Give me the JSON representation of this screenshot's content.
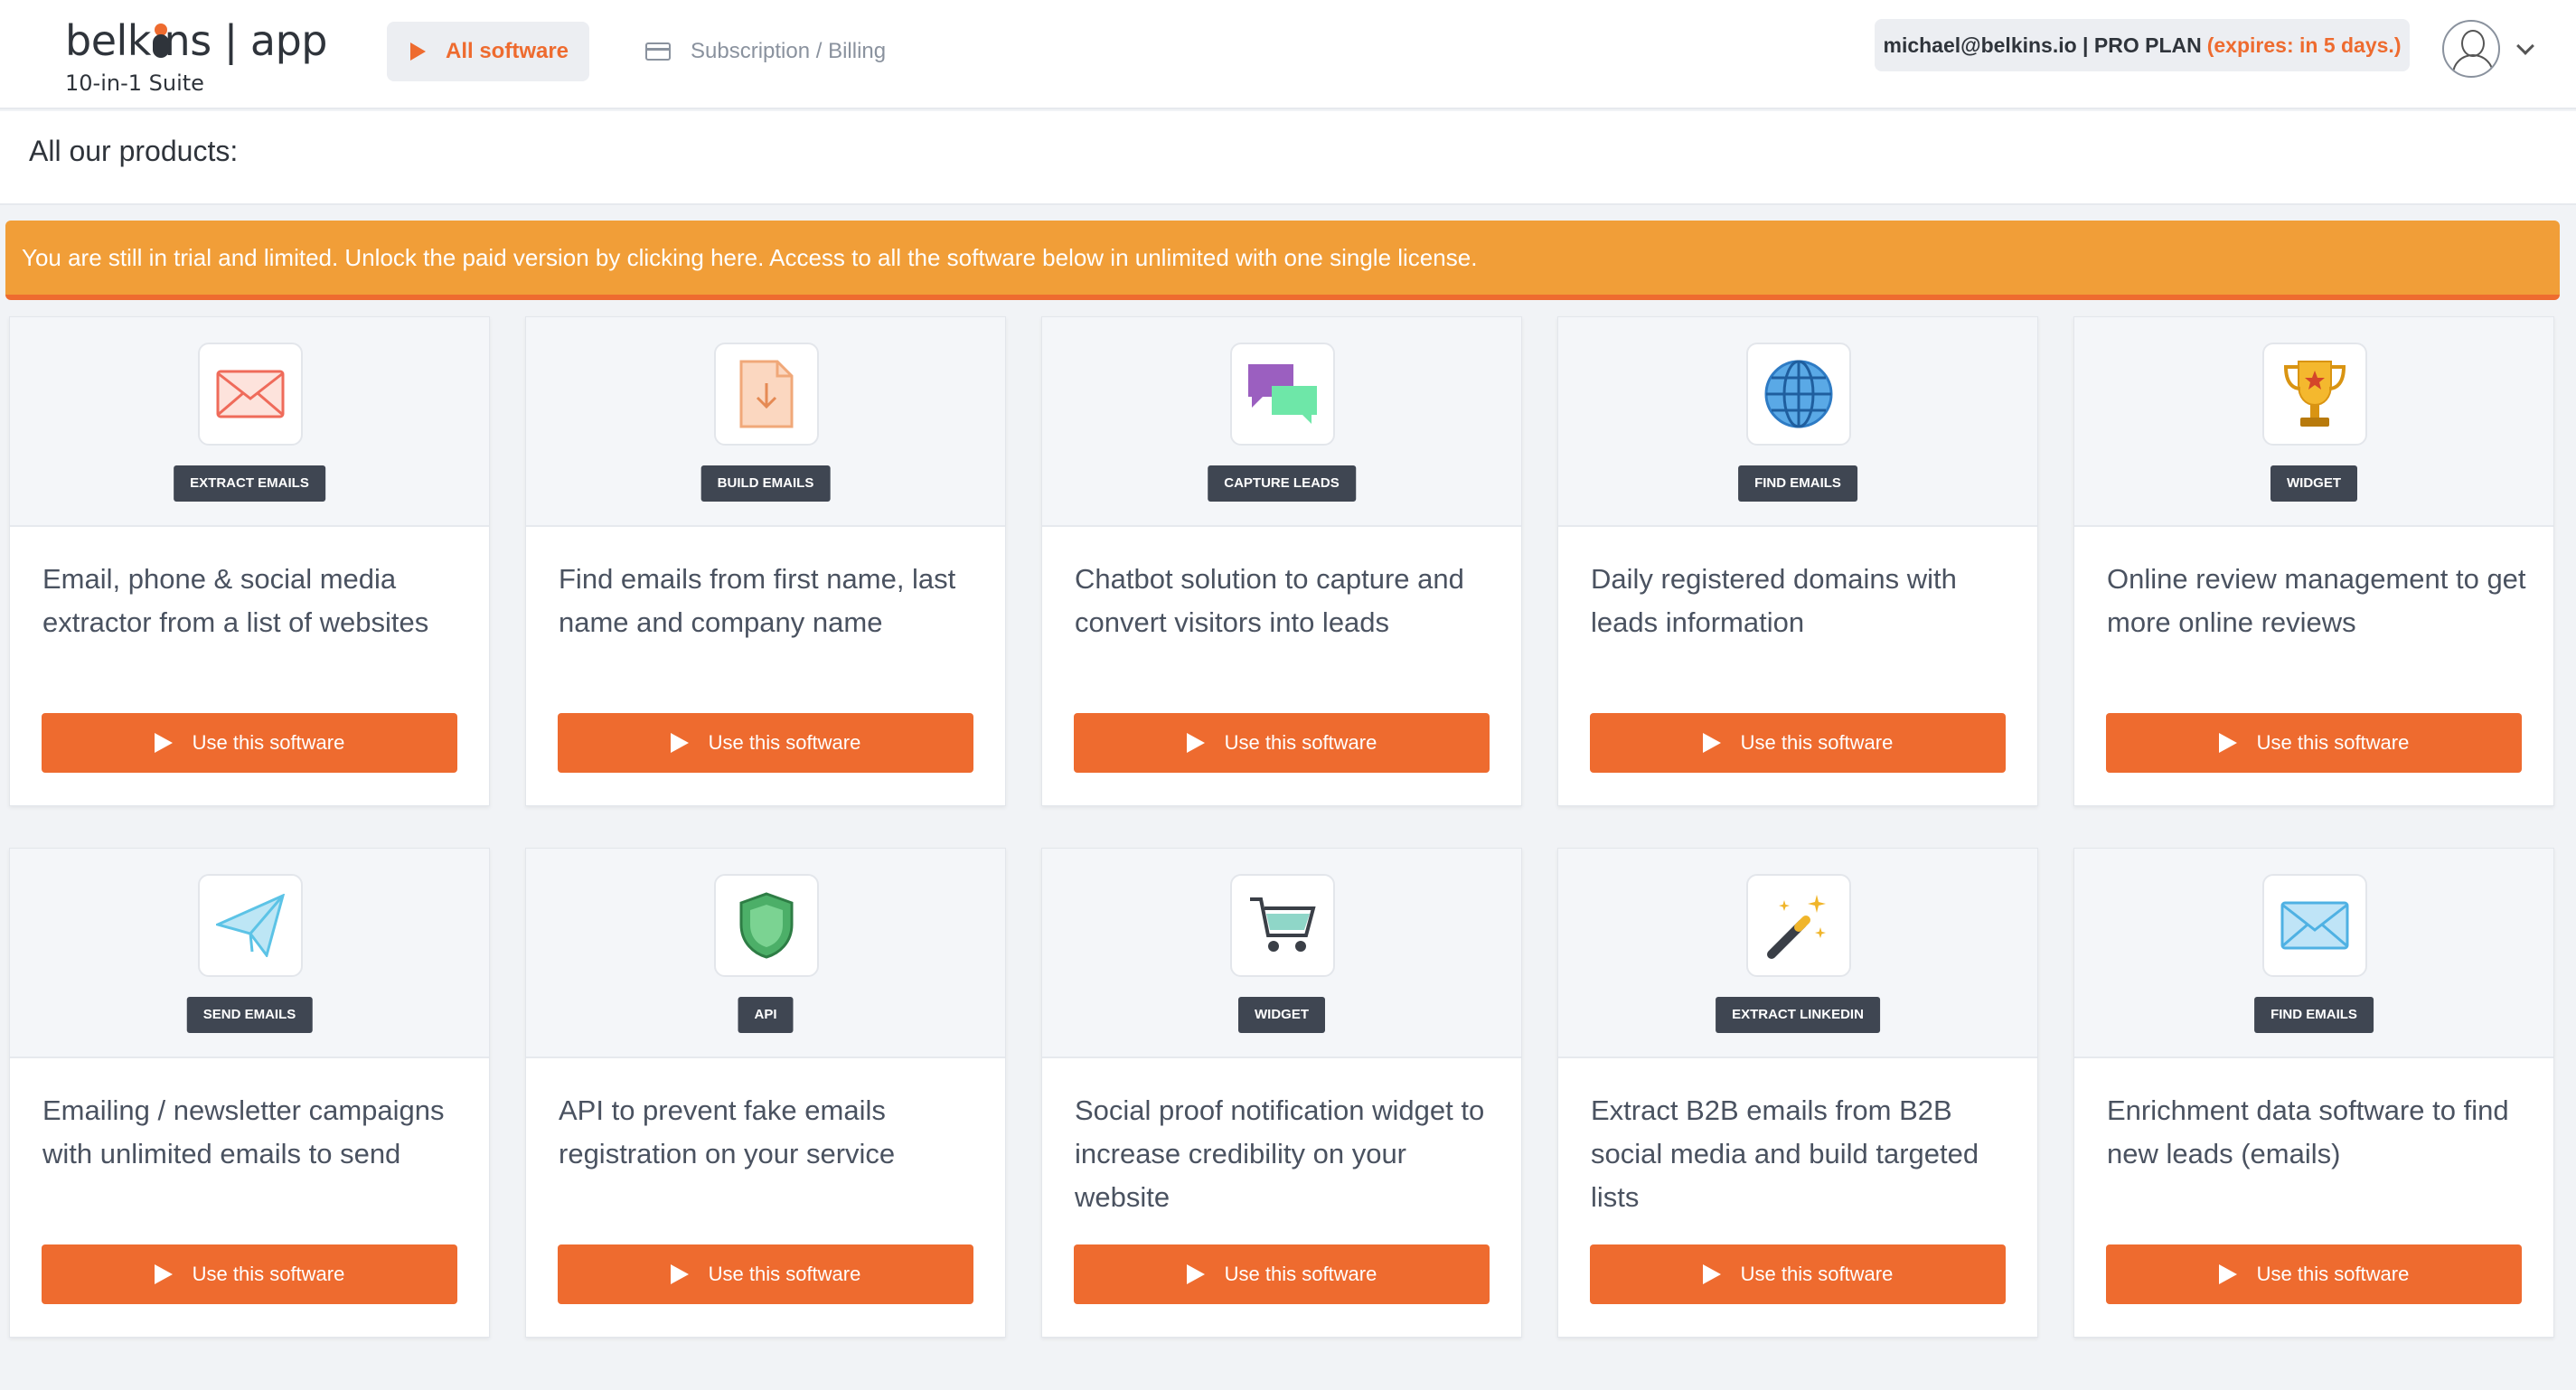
{
  "brand": {
    "name_left": "belk",
    "name_right": "ns | app",
    "subtitle": "10-in-1 Suite"
  },
  "nav": {
    "all_software": "All software",
    "billing": "Subscription / Billing"
  },
  "account": {
    "email_plan": "michael@belkins.io | PRO PLAN",
    "expires": "(expires: in 5 days.)"
  },
  "page": {
    "title": "All our products:"
  },
  "alert": {
    "text": "You are still in trial and limited. Unlock the paid version by clicking here. Access to all the software below in unlimited with one single license."
  },
  "colors": {
    "accent": "#ee6b2f",
    "alert": "#f19e38",
    "tag_bg": "#3f4652"
  },
  "products": [
    {
      "tag": "EXTRACT EMAILS",
      "icon": "envelope-icon",
      "description": "Email, phone & social media extractor from a list of websites",
      "button": "Use this software"
    },
    {
      "tag": "BUILD EMAILS",
      "icon": "file-download-icon",
      "description": "Find emails from first name, last name and company name",
      "button": "Use this software"
    },
    {
      "tag": "CAPTURE LEADS",
      "icon": "chat-bubbles-icon",
      "description": "Chatbot solution to capture and convert visitors into leads",
      "button": "Use this software"
    },
    {
      "tag": "FIND EMAILS",
      "icon": "globe-icon",
      "description": "Daily registered domains with leads information",
      "button": "Use this software"
    },
    {
      "tag": "WIDGET",
      "icon": "trophy-icon",
      "description": "Online review management to get more online reviews",
      "button": "Use this software"
    },
    {
      "tag": "SEND EMAILS",
      "icon": "paper-plane-icon",
      "description": "Emailing / newsletter campaigns with unlimited emails to send",
      "button": "Use this software"
    },
    {
      "tag": "API",
      "icon": "shield-icon",
      "description": "API to prevent fake emails registration on your service",
      "button": "Use this software"
    },
    {
      "tag": "WIDGET",
      "icon": "shopping-cart-icon",
      "description": "Social proof notification widget to increase credibility on your website",
      "button": "Use this software"
    },
    {
      "tag": "EXTRACT LINKEDIN",
      "icon": "magic-wand-icon",
      "description": "Extract B2B emails from B2B social media and build targeted lists",
      "button": "Use this software"
    },
    {
      "tag": "FIND EMAILS",
      "icon": "blue-envelope-icon",
      "description": "Enrichment data software to find new leads (emails)",
      "button": "Use this software"
    }
  ]
}
